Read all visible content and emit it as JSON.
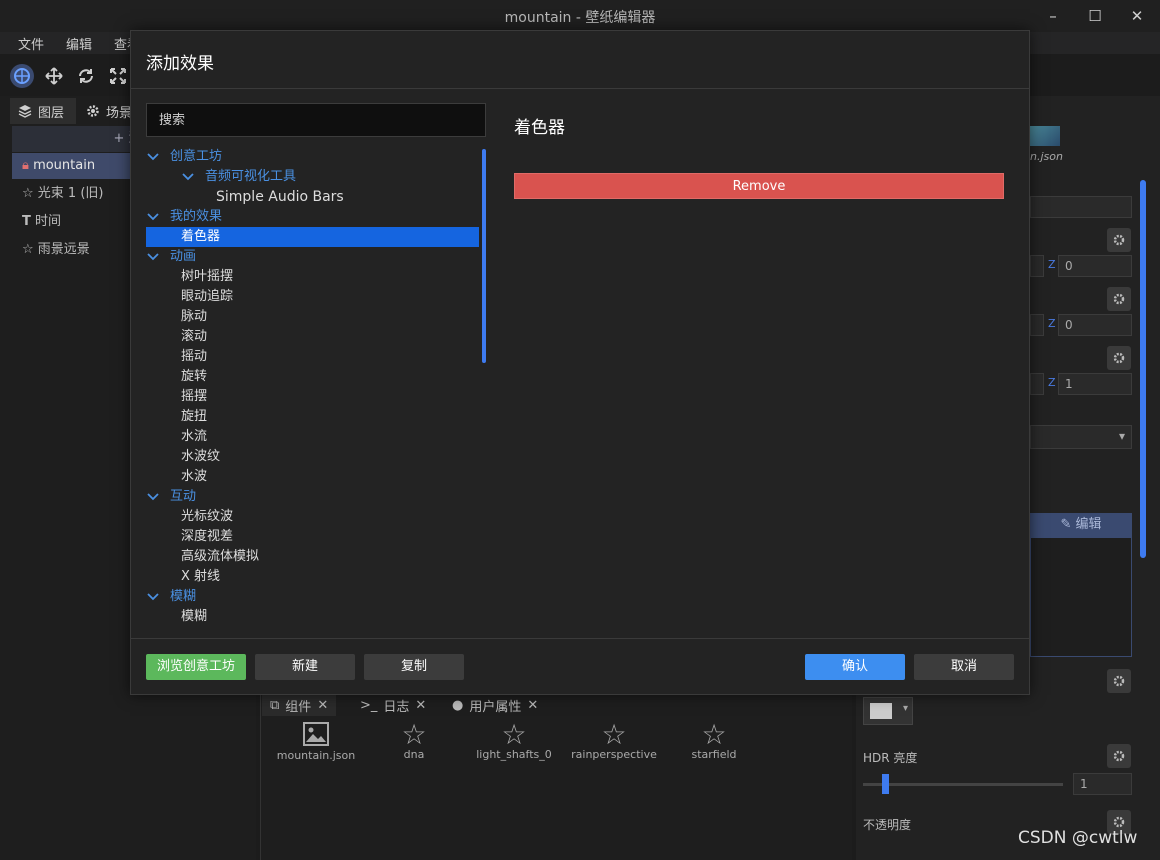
{
  "window": {
    "title": "mountain - 壁纸编辑器"
  },
  "menu": [
    "文件",
    "编辑",
    "查看"
  ],
  "left_tabs": {
    "layers": "图层",
    "scene": "场景"
  },
  "layers": {
    "add_label": "+ 添加",
    "items": [
      "mountain",
      "光束 1 (旧)",
      "时间",
      "雨景远景"
    ]
  },
  "right_panel": {
    "file_label": "n.json",
    "z_label": "Z",
    "z_values": [
      "0",
      "0",
      "1"
    ],
    "edit_label": "编辑",
    "hdr_label": "HDR 亮度",
    "hdr_value": "1",
    "opacity_label": "不透明度"
  },
  "bottom": {
    "tabs": [
      "组件",
      "日志",
      "用户属性"
    ],
    "assets": [
      "mountain.json",
      "dna",
      "light_shafts_0",
      "rainperspective",
      "starfield"
    ]
  },
  "dialog": {
    "title": "添加效果",
    "search_placeholder": "搜索",
    "tree": {
      "workshop": {
        "label": "创意工坊",
        "audio_group": "音频可视化工具",
        "audio_items": [
          "Simple Audio Bars"
        ]
      },
      "my_effects": {
        "label": "我的效果",
        "items": [
          "着色器"
        ]
      },
      "animation": {
        "label": "动画",
        "items": [
          "树叶摇摆",
          "眼动追踪",
          "脉动",
          "滚动",
          "摇动",
          "旋转",
          "摇摆",
          "旋扭",
          "水流",
          "水波纹",
          "水波"
        ]
      },
      "interaction": {
        "label": "互动",
        "items": [
          "光标纹波",
          "深度视差",
          "高级流体模拟",
          "X 射线"
        ]
      },
      "blur": {
        "label": "模糊",
        "items": [
          "模糊"
        ]
      }
    },
    "detail_title": "着色器",
    "remove_label": "Remove",
    "buttons": {
      "browse": "浏览创意工坊",
      "new": "新建",
      "copy": "复制",
      "ok": "确认",
      "cancel": "取消"
    }
  },
  "watermark": "CSDN @cwtlw",
  "colors": {
    "accent": "#3d8ef0",
    "selected": "#1565e0",
    "danger": "#d9534f",
    "success": "#5cb85c",
    "category": "#4a90e2"
  }
}
